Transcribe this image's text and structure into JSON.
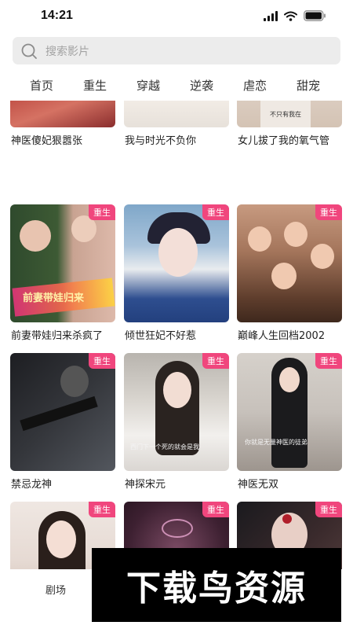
{
  "status_bar": {
    "time": "14:21"
  },
  "search": {
    "placeholder": "搜索影片"
  },
  "tabs": [
    {
      "label": "首页"
    },
    {
      "label": "重生"
    },
    {
      "label": "穿越"
    },
    {
      "label": "逆袭"
    },
    {
      "label": "虐恋"
    },
    {
      "label": "甜宠"
    }
  ],
  "cards": [
    {
      "title": "神医傻妃狠嚣张",
      "badge": "",
      "poster_text": ""
    },
    {
      "title": "我与时光不负你",
      "badge": "",
      "poster_text": ""
    },
    {
      "title": "女儿拔了我的氧气管",
      "badge": "",
      "poster_text": "不只有我在"
    },
    {
      "title": "前妻带娃归来杀疯了",
      "badge": "重生",
      "poster_text": "前妻带娃归来"
    },
    {
      "title": "倾世狂妃不好惹",
      "badge": "重生",
      "poster_text": ""
    },
    {
      "title": "巅峰人生回档2002",
      "badge": "重生",
      "poster_text": ""
    },
    {
      "title": "禁忌龙神",
      "badge": "重生",
      "poster_text": ""
    },
    {
      "title": "神探宋元",
      "badge": "重生",
      "poster_text": "西门下一个死的就会是我"
    },
    {
      "title": "神医无双",
      "badge": "重生",
      "poster_text": "你就是无量神医的徒弟"
    },
    {
      "title": "",
      "badge": "重生",
      "poster_text": ""
    },
    {
      "title": "",
      "badge": "重生",
      "poster_text": ""
    },
    {
      "title": "",
      "badge": "重生",
      "poster_text": ""
    }
  ],
  "bottom_nav": {
    "theater_label": "剧场"
  },
  "watermark": {
    "text": "下载鸟资源"
  }
}
